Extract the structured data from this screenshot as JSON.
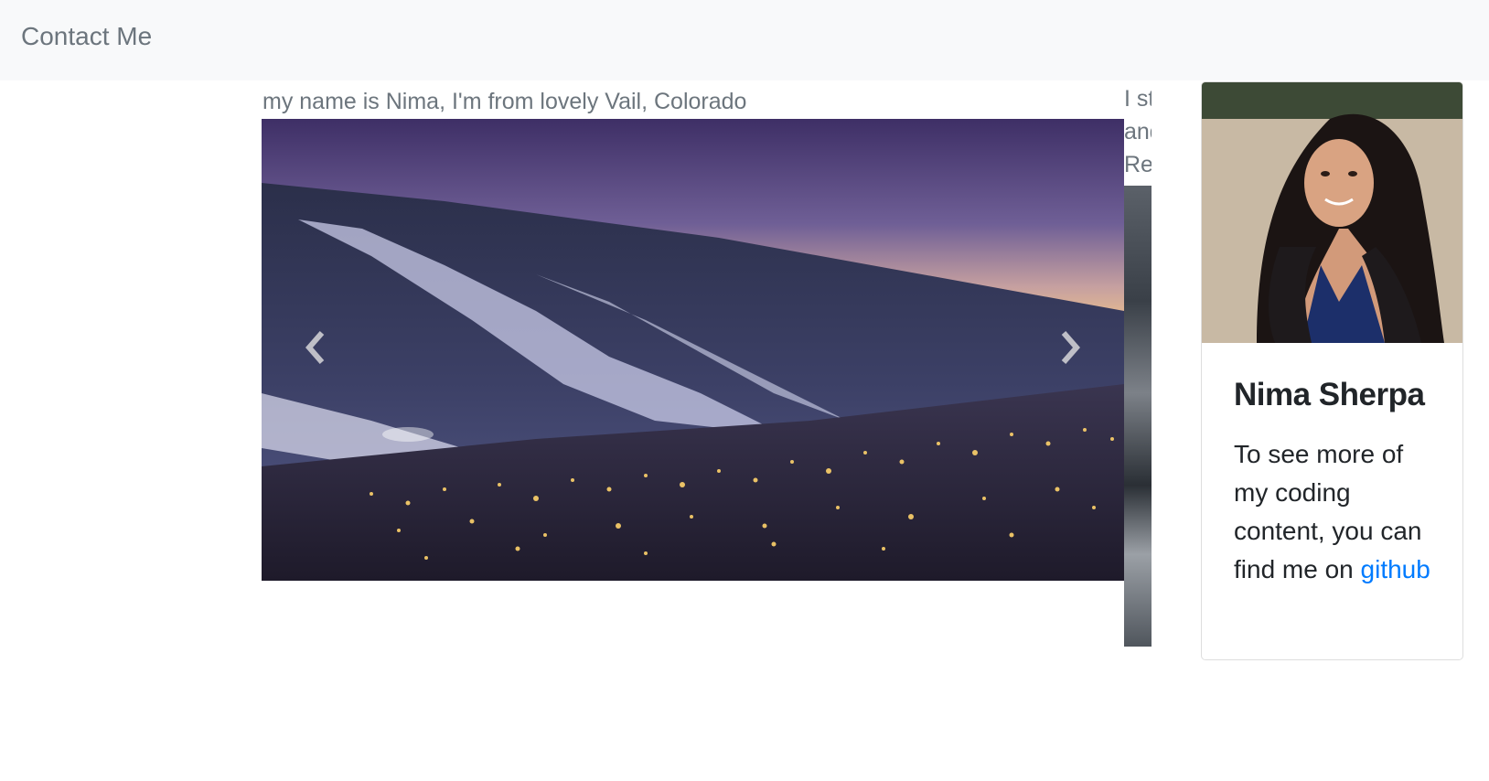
{
  "nav": {
    "link_label": "Contact Me"
  },
  "carousel": {
    "active_caption": "my name is Nima, I'm from lovely Vail, Colorado",
    "next_caption_lines": [
      "I st",
      "and",
      "Re"
    ],
    "active_image_icon": "vail-night-landscape-image",
    "prev_icon": "chevron-left-icon",
    "next_icon": "chevron-right-icon"
  },
  "profile": {
    "name": "Nima Sherpa",
    "text_before_link": "To see more of my coding content, you can find me on ",
    "link_label": "github",
    "link_color": "#007bff"
  }
}
